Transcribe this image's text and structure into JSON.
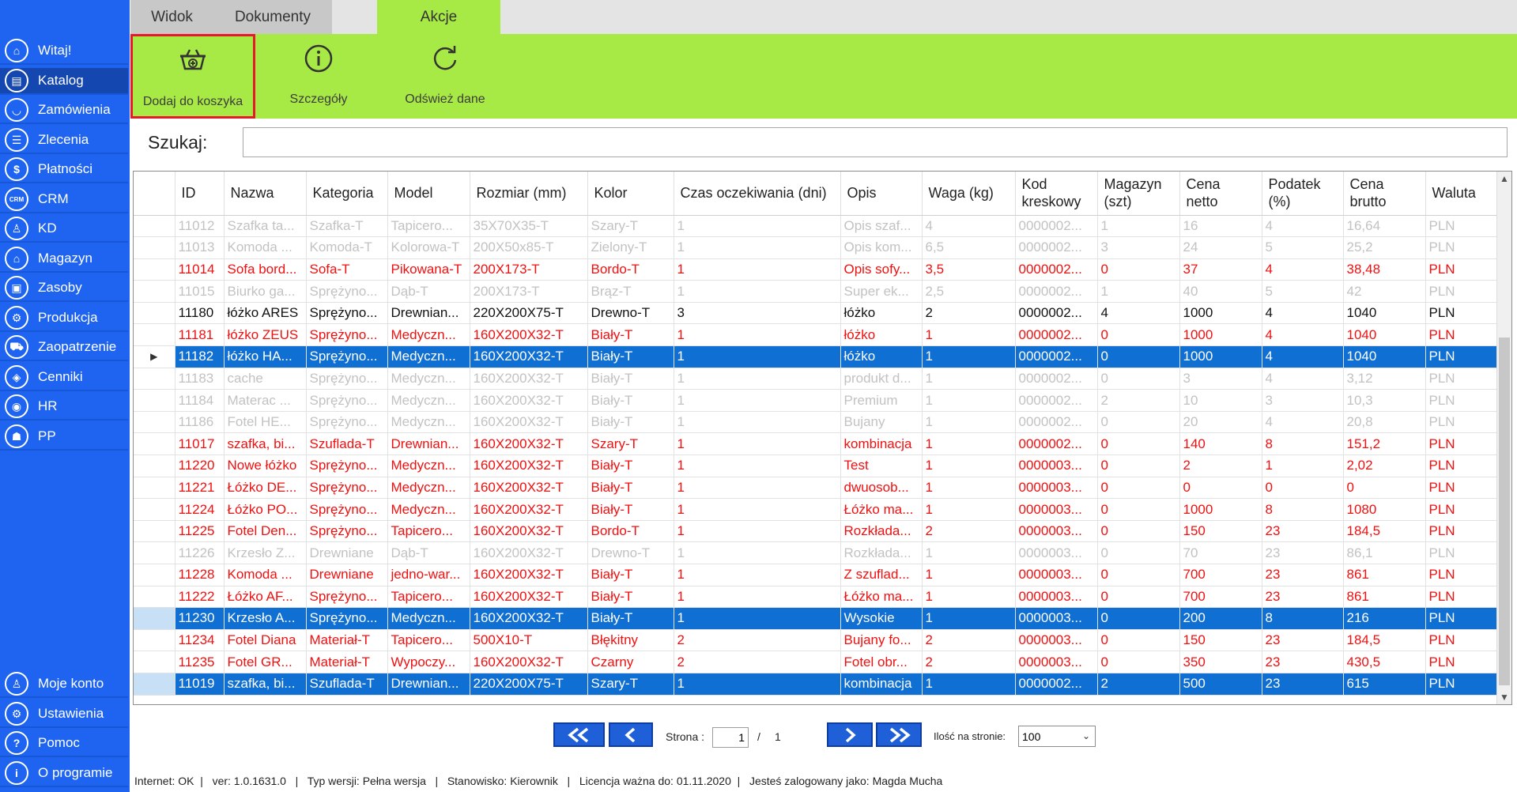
{
  "sidebar": {
    "items": [
      {
        "label": "Witaj!",
        "icon": "home-icon",
        "glyph": "⌂"
      },
      {
        "label": "Katalog",
        "icon": "book-icon",
        "glyph": "▤"
      },
      {
        "label": "Zamówienia",
        "icon": "cart-icon",
        "glyph": "◡"
      },
      {
        "label": "Zlecenia",
        "icon": "list-icon",
        "glyph": "☰"
      },
      {
        "label": "Płatności",
        "icon": "dollar-icon",
        "glyph": "$"
      },
      {
        "label": "CRM",
        "icon": "crm-icon",
        "glyph": "CRM"
      },
      {
        "label": "KD",
        "icon": "person-icon",
        "glyph": "♙"
      },
      {
        "label": "Magazyn",
        "icon": "warehouse-icon",
        "glyph": "⌂"
      },
      {
        "label": "Zasoby",
        "icon": "resources-icon",
        "glyph": "▣"
      },
      {
        "label": "Produkcja",
        "icon": "production-icon",
        "glyph": "⚙"
      },
      {
        "label": "Zaopatrzenie",
        "icon": "truck-icon",
        "glyph": "⛟"
      },
      {
        "label": "Cenniki",
        "icon": "price-tag-icon",
        "glyph": "◈"
      },
      {
        "label": "HR",
        "icon": "hr-icon",
        "glyph": "◉"
      },
      {
        "label": "PP",
        "icon": "pp-icon",
        "glyph": "☗"
      }
    ],
    "bottom_items": [
      {
        "label": "Moje konto",
        "icon": "user-icon",
        "glyph": "♙"
      },
      {
        "label": "Ustawienia",
        "icon": "settings-icon",
        "glyph": "⚙"
      },
      {
        "label": "Pomoc",
        "icon": "help-icon",
        "glyph": "?"
      },
      {
        "label": "O programie",
        "icon": "info-icon",
        "glyph": "i"
      }
    ],
    "active_index": 1
  },
  "tabs": [
    {
      "label": "Widok",
      "state": "inactive"
    },
    {
      "label": "Dokumenty",
      "state": "inactive"
    },
    {
      "label": "Akcje",
      "state": "active"
    }
  ],
  "ribbon": {
    "add_to_cart_label": "Dodaj do koszyka",
    "details_label": "Szczegóły",
    "refresh_label": "Odśwież dane"
  },
  "search": {
    "label": "Szukaj:",
    "value": ""
  },
  "table": {
    "headers": [
      "ID",
      "Nazwa",
      "Kategoria",
      "Model",
      "Rozmiar (mm)",
      "Kolor",
      "Czas oczekiwania (dni)",
      "Opis",
      "Waga (kg)",
      "Kod kreskowy",
      "Magazyn (szt)",
      "Cena netto",
      "Podatek (%)",
      "Cena brutto",
      "Waluta"
    ],
    "rows": [
      {
        "style": "gray",
        "marker": "",
        "cells": [
          "11012",
          "Szafka ta...",
          "Szafka-T",
          "Tapicero...",
          "35X70X35-T",
          "Szary-T",
          "1",
          "Opis szaf...",
          "4",
          "0000002...",
          "1",
          "16",
          "4",
          "16,64",
          "PLN"
        ]
      },
      {
        "style": "gray",
        "marker": "",
        "cells": [
          "11013",
          "Komoda ...",
          "Komoda-T",
          "Kolorowa-T",
          "200X50x85-T",
          "Zielony-T",
          "1",
          "Opis kom...",
          "6,5",
          "0000002...",
          "3",
          "24",
          "5",
          "25,2",
          "PLN"
        ]
      },
      {
        "style": "red",
        "marker": "",
        "cells": [
          "11014",
          "Sofa bord...",
          "Sofa-T",
          "Pikowana-T",
          "200X173-T",
          "Bordo-T",
          "1",
          "Opis sofy...",
          "3,5",
          "0000002...",
          "0",
          "37",
          "4",
          "38,48",
          "PLN"
        ]
      },
      {
        "style": "gray",
        "marker": "",
        "cells": [
          "11015",
          "Biurko ga...",
          "Sprężyno...",
          "Dąb-T",
          "200X173-T",
          "Brąz-T",
          "1",
          "Super ek...",
          "2,5",
          "0000002...",
          "1",
          "40",
          "5",
          "42",
          "PLN"
        ]
      },
      {
        "style": "black",
        "marker": "",
        "cells": [
          "11180",
          "łóżko ARES",
          "Sprężyno...",
          "Drewnian...",
          "220X200X75-T",
          "Drewno-T",
          "3",
          "łóżko",
          "2",
          "0000002...",
          "4",
          "1000",
          "4",
          "1040",
          "PLN"
        ]
      },
      {
        "style": "red",
        "marker": "",
        "cells": [
          "11181",
          "łóżko ZEUS",
          "Sprężyno...",
          "Medyczn...",
          "160X200X32-T",
          "Biały-T",
          "1",
          "łóżko",
          "1",
          "0000002...",
          "0",
          "1000",
          "4",
          "1040",
          "PLN"
        ]
      },
      {
        "style": "selected",
        "marker": "▶",
        "cells": [
          "11182",
          "łóżko HA...",
          "Sprężyno...",
          "Medyczn...",
          "160X200X32-T",
          "Biały-T",
          "1",
          "łóżko",
          "1",
          "0000002...",
          "0",
          "1000",
          "4",
          "1040",
          "PLN"
        ]
      },
      {
        "style": "gray",
        "marker": "",
        "cells": [
          "11183",
          "cache",
          "Sprężyno...",
          "Medyczn...",
          "160X200X32-T",
          "Biały-T",
          "1",
          "produkt d...",
          "1",
          "0000002...",
          "0",
          "3",
          "4",
          "3,12",
          "PLN"
        ]
      },
      {
        "style": "gray",
        "marker": "",
        "cells": [
          "11184",
          "Materac ...",
          "Sprężyno...",
          "Medyczn...",
          "160X200X32-T",
          "Biały-T",
          "1",
          "Premium",
          "1",
          "0000002...",
          "2",
          "10",
          "3",
          "10,3",
          "PLN"
        ]
      },
      {
        "style": "gray",
        "marker": "",
        "cells": [
          "11186",
          "Fotel HE...",
          "Sprężyno...",
          "Medyczn...",
          "160X200X32-T",
          "Biały-T",
          "1",
          "Bujany",
          "1",
          "0000002...",
          "0",
          "20",
          "4",
          "20,8",
          "PLN"
        ]
      },
      {
        "style": "red",
        "marker": "",
        "cells": [
          "11017",
          "szafka, bi...",
          "Szuflada-T",
          "Drewnian...",
          "160X200X32-T",
          "Szary-T",
          "1",
          "kombinacja",
          "1",
          "0000002...",
          "0",
          "140",
          "8",
          "151,2",
          "PLN"
        ]
      },
      {
        "style": "red",
        "marker": "",
        "cells": [
          "11220",
          "Nowe łóżko",
          "Sprężyno...",
          "Medyczn...",
          "160X200X32-T",
          "Biały-T",
          "1",
          "Test",
          "1",
          "0000003...",
          "0",
          "2",
          "1",
          "2,02",
          "PLN"
        ]
      },
      {
        "style": "red",
        "marker": "",
        "cells": [
          "11221",
          "Łóżko DE...",
          "Sprężyno...",
          "Medyczn...",
          "160X200X32-T",
          "Biały-T",
          "1",
          "dwuosob...",
          "1",
          "0000003...",
          "0",
          "0",
          "0",
          "0",
          "PLN"
        ]
      },
      {
        "style": "red",
        "marker": "",
        "cells": [
          "11224",
          "Łóżko PO...",
          "Sprężyno...",
          "Medyczn...",
          "160X200X32-T",
          "Biały-T",
          "1",
          "Łóżko ma...",
          "1",
          "0000003...",
          "0",
          "1000",
          "8",
          "1080",
          "PLN"
        ]
      },
      {
        "style": "red",
        "marker": "",
        "cells": [
          "11225",
          "Fotel Den...",
          "Sprężyno...",
          "Tapicero...",
          "160X200X32-T",
          "Bordo-T",
          "1",
          "Rozkłada...",
          "2",
          "0000003...",
          "0",
          "150",
          "23",
          "184,5",
          "PLN"
        ]
      },
      {
        "style": "gray",
        "marker": "",
        "cells": [
          "11226",
          "Krzesło Z...",
          "Drewniane",
          "Dąb-T",
          "160X200X32-T",
          "Drewno-T",
          "1",
          "Rozkłada...",
          "1",
          "0000003...",
          "0",
          "70",
          "23",
          "86,1",
          "PLN"
        ]
      },
      {
        "style": "red",
        "marker": "",
        "cells": [
          "11228",
          "Komoda ...",
          "Drewniane",
          "jedno-war...",
          "160X200X32-T",
          "Biały-T",
          "1",
          "Z szuflad...",
          "1",
          "0000003...",
          "0",
          "700",
          "23",
          "861",
          "PLN"
        ]
      },
      {
        "style": "red",
        "marker": "",
        "cells": [
          "11222",
          "Łóżko AF...",
          "Sprężyno...",
          "Tapicero...",
          "160X200X32-T",
          "Biały-T",
          "1",
          "Łóżko ma...",
          "1",
          "0000003...",
          "0",
          "700",
          "23",
          "861",
          "PLN"
        ]
      },
      {
        "style": "selected-light",
        "marker": "",
        "cells": [
          "11230",
          "Krzesło A...",
          "Sprężyno...",
          "Medyczn...",
          "160X200X32-T",
          "Biały-T",
          "1",
          "Wysokie",
          "1",
          "0000003...",
          "0",
          "200",
          "8",
          "216",
          "PLN"
        ]
      },
      {
        "style": "red",
        "marker": "",
        "cells": [
          "11234",
          "Fotel Diana",
          "Materiał-T",
          "Tapicero...",
          "500X10-T",
          "Błękitny",
          "2",
          "Bujany fo...",
          "2",
          "0000003...",
          "0",
          "150",
          "23",
          "184,5",
          "PLN"
        ]
      },
      {
        "style": "red",
        "marker": "",
        "cells": [
          "11235",
          "Fotel GR...",
          "Materiał-T",
          "Wypoczy...",
          "160X200X32-T",
          "Czarny",
          "2",
          "Fotel obr...",
          "2",
          "0000003...",
          "0",
          "350",
          "23",
          "430,5",
          "PLN"
        ]
      },
      {
        "style": "selected-light",
        "marker": "",
        "cells": [
          "11019",
          "szafka, bi...",
          "Szuflada-T",
          "Drewnian...",
          "220X200X75-T",
          "Szary-T",
          "1",
          "kombinacja",
          "1",
          "0000002...",
          "2",
          "500",
          "23",
          "615",
          "PLN"
        ]
      }
    ]
  },
  "pager": {
    "first_icon": "double-chevron-left-icon",
    "prev_icon": "chevron-left-icon",
    "next_icon": "chevron-right-icon",
    "last_icon": "double-chevron-right-icon",
    "page_label": "Strona :",
    "page_value": "1",
    "separator": "/",
    "total_pages": "1",
    "page_size_label": "Ilość na stronie:",
    "page_size_value": "100"
  },
  "status": {
    "text": "Internet: OK  |   ver: 1.0.1631.0   |   Typ wersji: Pełna wersja   |   Stanowisko: Kierownik   |   Licencja ważna do: 01.11.2020  |   Jesteś zalogowany jako: Magda Mucha"
  },
  "colors": {
    "sidebar": "#1f64f0",
    "ribbon": "#a8ea45",
    "selected_row": "#0f6fd2",
    "highlight_border": "#e6192a",
    "inactive_row_text": "#f01010"
  }
}
